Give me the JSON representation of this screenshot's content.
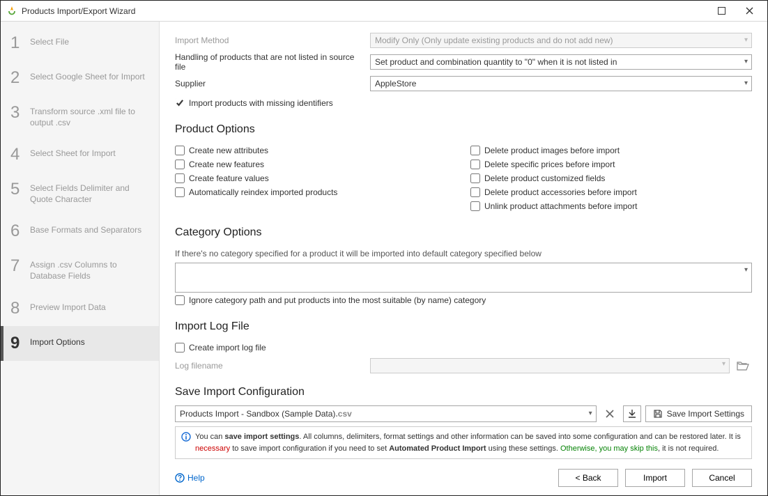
{
  "window": {
    "title": "Products Import/Export Wizard"
  },
  "steps": [
    {
      "n": "1",
      "label": "Select File"
    },
    {
      "n": "2",
      "label": "Select Google Sheet for Import"
    },
    {
      "n": "3",
      "label": "Transform source .xml file to output .csv"
    },
    {
      "n": "4",
      "label": "Select Sheet for Import"
    },
    {
      "n": "5",
      "label": "Select Fields Delimiter and Quote Character"
    },
    {
      "n": "6",
      "label": "Base Formats and Separators"
    },
    {
      "n": "7",
      "label": "Assign .csv Columns to Database Fields"
    },
    {
      "n": "8",
      "label": "Preview Import Data"
    },
    {
      "n": "9",
      "label": "Import Options"
    }
  ],
  "import": {
    "method_label": "Import Method",
    "method_value": "Modify Only (Only update existing products and do not add new)",
    "handling_label": "Handling of products that are not listed in source file",
    "handling_value": "Set product and combination quantity to \"0\" when it is not listed in",
    "supplier_label": "Supplier",
    "supplier_value": "AppleStore",
    "missing_ids_label": "Import products with missing identifiers"
  },
  "product_options": {
    "heading": "Product Options",
    "left": [
      "Create new attributes",
      "Create new features",
      "Create feature values",
      "Automatically reindex imported products"
    ],
    "right": [
      "Delete product images before import",
      "Delete specific prices before import",
      "Delete product customized fields",
      "Delete product accessories before import",
      "Unlink product attachments before import"
    ]
  },
  "category": {
    "heading": "Category Options",
    "desc": "If there's no category specified for a product it will be imported into default category specified below",
    "combo": "",
    "ignore_label": "Ignore category path and put products into the most suitable (by name) category"
  },
  "log": {
    "heading": "Import Log File",
    "create_label": "Create import log file",
    "filename_label": "Log filename"
  },
  "save": {
    "heading": "Save Import Configuration",
    "name": "Products Import - Sandbox (Sample Data)",
    "ext": ".csv",
    "save_btn": "Save Import Settings",
    "info_p1a": "You can ",
    "info_p1b": "save import settings",
    "info_p1c": ". All columns, delimiters, format settings and other information can be saved into some configuration and can be restored later. It is ",
    "info_nec": "necessary",
    "info_p1d": " to save import configuration if you need to set ",
    "info_api": "Automated Product Import",
    "info_p1e": " using these settings. ",
    "info_skip": "Otherwise, you may skip this",
    "info_p1f": ", it is not required."
  },
  "footer": {
    "help": "Help",
    "back": "< Back",
    "import": "Import",
    "cancel": "Cancel"
  }
}
